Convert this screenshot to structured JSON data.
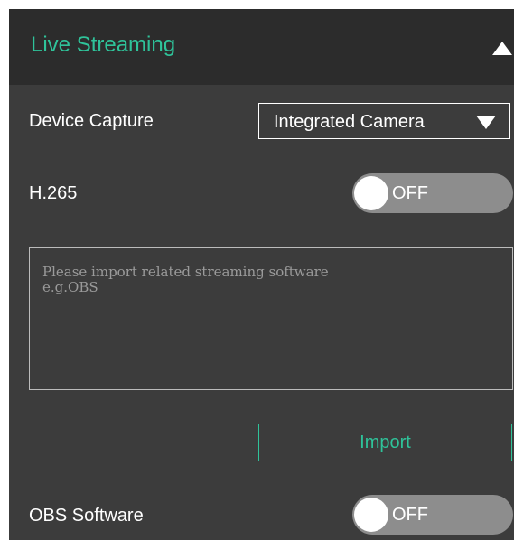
{
  "header": {
    "title": "Live Streaming",
    "collapse_icon": "triangle-up-icon"
  },
  "device_capture": {
    "label": "Device Capture",
    "selected": "Integrated Camera",
    "dropdown_icon": "triangle-down-icon"
  },
  "h265": {
    "label": "H.265",
    "toggle_state": "OFF"
  },
  "streaming_software": {
    "placeholder": "Please import related streaming software\ne.g.OBS",
    "value": ""
  },
  "import_button": {
    "label": "Import"
  },
  "obs_software": {
    "label": "OBS Software",
    "toggle_state": "OFF"
  },
  "colors": {
    "accent": "#2fc39a",
    "panel_background": "#3c3c3c",
    "header_background": "#2c2c2c",
    "toggle_track_off": "#8d8d8d"
  }
}
